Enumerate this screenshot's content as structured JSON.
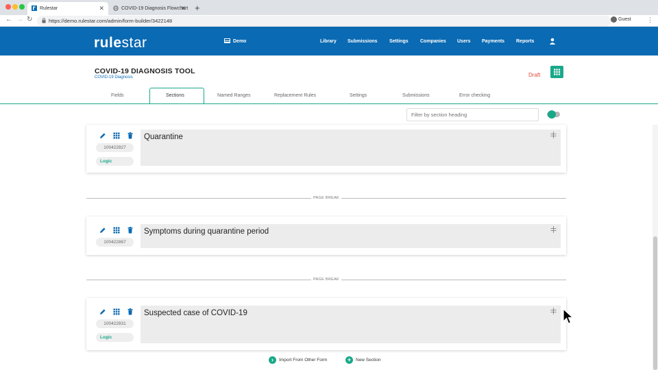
{
  "browser": {
    "tabs": [
      {
        "title": "Rulestar"
      },
      {
        "title": "COVID-19 Diagnosis Flowchart"
      }
    ],
    "url": "https://demo.rulestar.com/admin/form-builder/3422148",
    "profile": "Guest"
  },
  "app": {
    "logo_left": "rule",
    "logo_right": "star",
    "workspace": "Demo",
    "nav": [
      "Library",
      "Submissions",
      "Settings",
      "Companies",
      "Users",
      "Payments",
      "Reports"
    ]
  },
  "form": {
    "title": "COVID-19 DIAGNOSIS TOOL",
    "subtitle": "COVID-19 Diagnosis",
    "status": "Draft"
  },
  "tabs": [
    "Fields",
    "Sections",
    "Named Ranges",
    "Replacement Rules",
    "Settings",
    "Submissions",
    "Error checking"
  ],
  "active_tab": "Sections",
  "filter": {
    "placeholder": "Filter by section heading"
  },
  "sections": [
    {
      "heading": "Quarantine",
      "id": "100422827",
      "badge": "Logic"
    },
    {
      "heading": "Symptoms during quarantine period",
      "id": "100422867",
      "badge": ""
    },
    {
      "heading": "Suspected case of COVID-19",
      "id": "100422831",
      "badge": "Logic"
    }
  ],
  "page_break_label": "PAGE BREAK",
  "actions": {
    "import": "Import From Other Form",
    "new_section": "New Section"
  },
  "colors": {
    "brand_blue": "#0a6ab3",
    "accent_green": "#1aa88a",
    "draft_red": "#e04a3a"
  }
}
